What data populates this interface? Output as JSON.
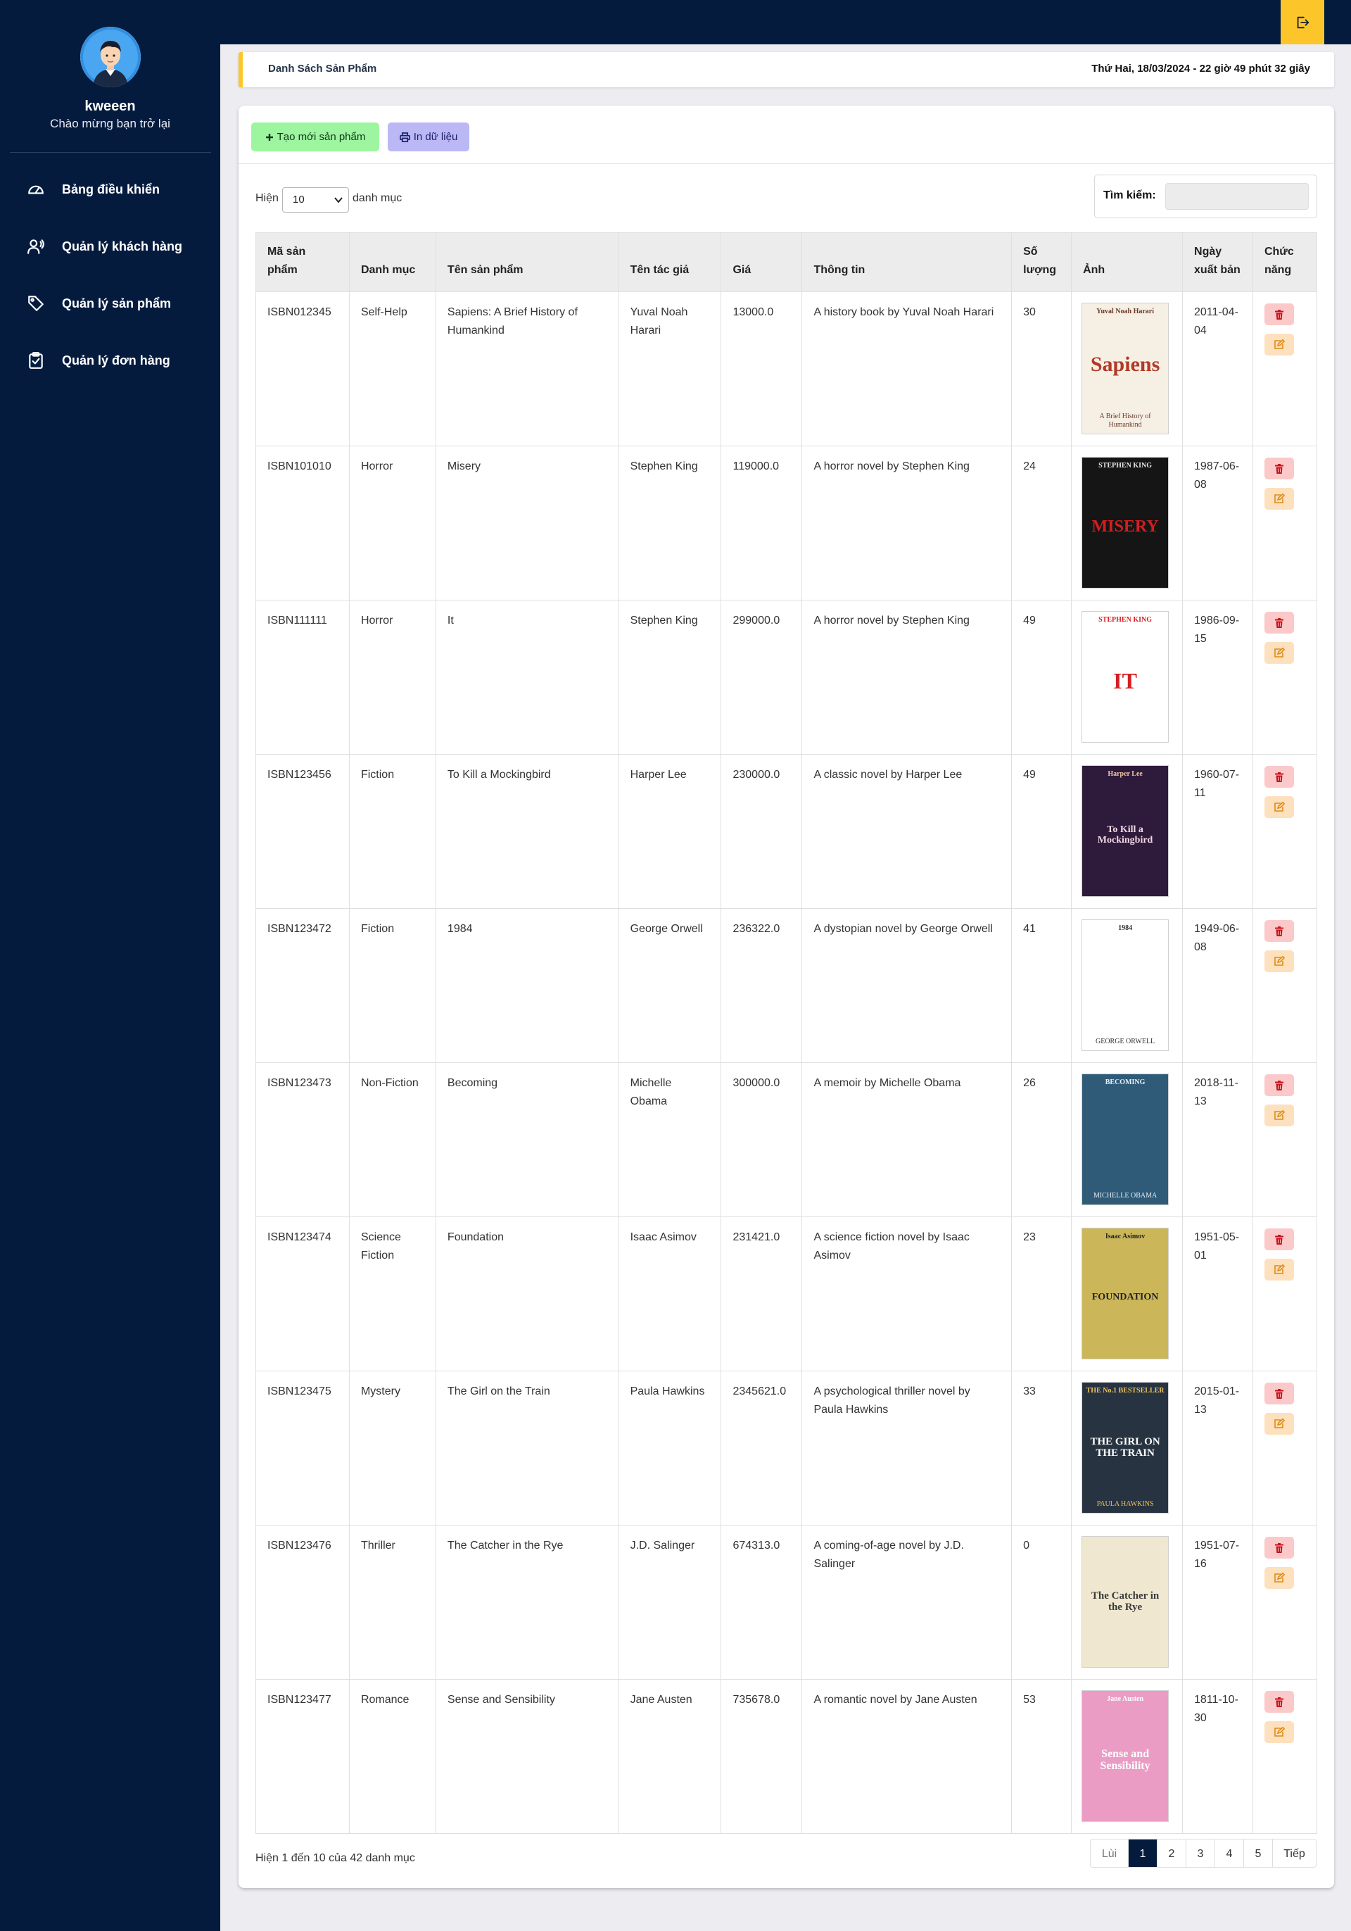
{
  "sidebar": {
    "username": "kweeen",
    "welcome": "Chào mừng bạn trở lại",
    "nav": [
      {
        "label": "Bảng điều khiển",
        "icon": "dashboard-icon"
      },
      {
        "label": "Quản lý khách hàng",
        "icon": "customers-icon"
      },
      {
        "label": "Quản lý sản phẩm",
        "icon": "tag-icon"
      },
      {
        "label": "Quản lý đơn hàng",
        "icon": "clipboard-icon"
      }
    ]
  },
  "header": {
    "title": "Danh Sách Sản Phẩm",
    "datetime": "Thứ Hai, 18/03/2024 - 22 giờ 49 phút 32 giây"
  },
  "toolbar": {
    "create_label": "Tạo mới sản phẩm",
    "print_label": "In dữ liệu"
  },
  "table_controls": {
    "show_prefix": "Hiện",
    "show_value": "10",
    "show_suffix": "danh mục",
    "search_label": "Tìm kiếm:",
    "search_value": ""
  },
  "table": {
    "headers": [
      "Mã sản phẩm",
      "Danh mục",
      "Tên sản phẩm",
      "Tên tác giả",
      "Giá",
      "Thông tin",
      "Số lượng",
      "Ảnh",
      "Ngày xuất bản",
      "Chức năng"
    ],
    "rows": [
      {
        "code": "ISBN012345",
        "category": "Self-Help",
        "name": "Sapiens: A Brief History of Humankind",
        "author": "Yuval Noah Harari",
        "price": "13000.0",
        "info": "A history book by Yuval Noah Harari",
        "qty": "30",
        "date": "2011-04-04",
        "cover": {
          "top": "Yuval Noah Harari",
          "mid": "Sapiens",
          "bottom": "A Brief History of Humankind"
        }
      },
      {
        "code": "ISBN101010",
        "category": "Horror",
        "name": "Misery",
        "author": "Stephen King",
        "price": "119000.0",
        "info": "A horror novel by Stephen King",
        "qty": "24",
        "date": "1987-06-08",
        "cover": {
          "top": "STEPHEN KING",
          "mid": "MISERY",
          "bottom": ""
        }
      },
      {
        "code": "ISBN111111",
        "category": "Horror",
        "name": "It",
        "author": "Stephen King",
        "price": "299000.0",
        "info": "A horror novel by Stephen King",
        "qty": "49",
        "date": "1986-09-15",
        "cover": {
          "top": "STEPHEN KING",
          "mid": "IT",
          "bottom": ""
        }
      },
      {
        "code": "ISBN123456",
        "category": "Fiction",
        "name": "To Kill a Mockingbird",
        "author": "Harper Lee",
        "price": "230000.0",
        "info": "A classic novel by Harper Lee",
        "qty": "49",
        "date": "1960-07-11",
        "cover": {
          "top": "Harper Lee",
          "mid": "To Kill a Mockingbird",
          "bottom": ""
        }
      },
      {
        "code": "ISBN123472",
        "category": "Fiction",
        "name": "1984",
        "author": "George Orwell",
        "price": "236322.0",
        "info": "A dystopian novel by George Orwell",
        "qty": "41",
        "date": "1949-06-08",
        "cover": {
          "top": "1984",
          "mid": "",
          "bottom": "GEORGE ORWELL"
        }
      },
      {
        "code": "ISBN123473",
        "category": "Non-Fiction",
        "name": "Becoming",
        "author": "Michelle Obama",
        "price": "300000.0",
        "info": "A memoir by Michelle Obama",
        "qty": "26",
        "date": "2018-11-13",
        "cover": {
          "top": "BECOMING",
          "mid": "",
          "bottom": "MICHELLE OBAMA"
        }
      },
      {
        "code": "ISBN123474",
        "category": "Science Fiction",
        "name": "Foundation",
        "author": "Isaac Asimov",
        "price": "231421.0",
        "info": "A science fiction novel by Isaac Asimov",
        "qty": "23",
        "date": "1951-05-01",
        "cover": {
          "top": "Isaac Asimov",
          "mid": "FOUNDATION",
          "bottom": ""
        }
      },
      {
        "code": "ISBN123475",
        "category": "Mystery",
        "name": "The Girl on the Train",
        "author": "Paula Hawkins",
        "price": "2345621.0",
        "info": "A psychological thriller novel by Paula Hawkins",
        "qty": "33",
        "date": "2015-01-13",
        "cover": {
          "top": "THE No.1 BESTSELLER",
          "mid": "THE GIRL ON THE TRAIN",
          "bottom": "PAULA HAWKINS"
        }
      },
      {
        "code": "ISBN123476",
        "category": "Thriller",
        "name": "The Catcher in the Rye",
        "author": "J.D. Salinger",
        "price": "674313.0",
        "info": "A coming-of-age novel by J.D. Salinger",
        "qty": "0",
        "date": "1951-07-16",
        "cover": {
          "top": "",
          "mid": "The Catcher in the Rye",
          "bottom": ""
        }
      },
      {
        "code": "ISBN123477",
        "category": "Romance",
        "name": "Sense and Sensibility",
        "author": "Jane Austen",
        "price": "735678.0",
        "info": "A romantic novel by Jane Austen",
        "qty": "53",
        "date": "1811-10-30",
        "cover": {
          "top": "Jane Austen",
          "mid": "Sense and Sensibility",
          "bottom": ""
        }
      }
    ]
  },
  "footer": {
    "info": "Hiện 1 đến 10 của 42 danh mục",
    "prev": "Lùi",
    "pages": [
      "1",
      "2",
      "3",
      "4",
      "5"
    ],
    "active_page": "1",
    "next": "Tiếp"
  },
  "colors": {
    "navy": "#041b3e",
    "accent_yellow": "#fcc62b",
    "create_green": "#9df59f",
    "print_purple": "#bbb8f5",
    "delete_red": "#fbc9c9",
    "edit_orange": "#fde0bd"
  }
}
